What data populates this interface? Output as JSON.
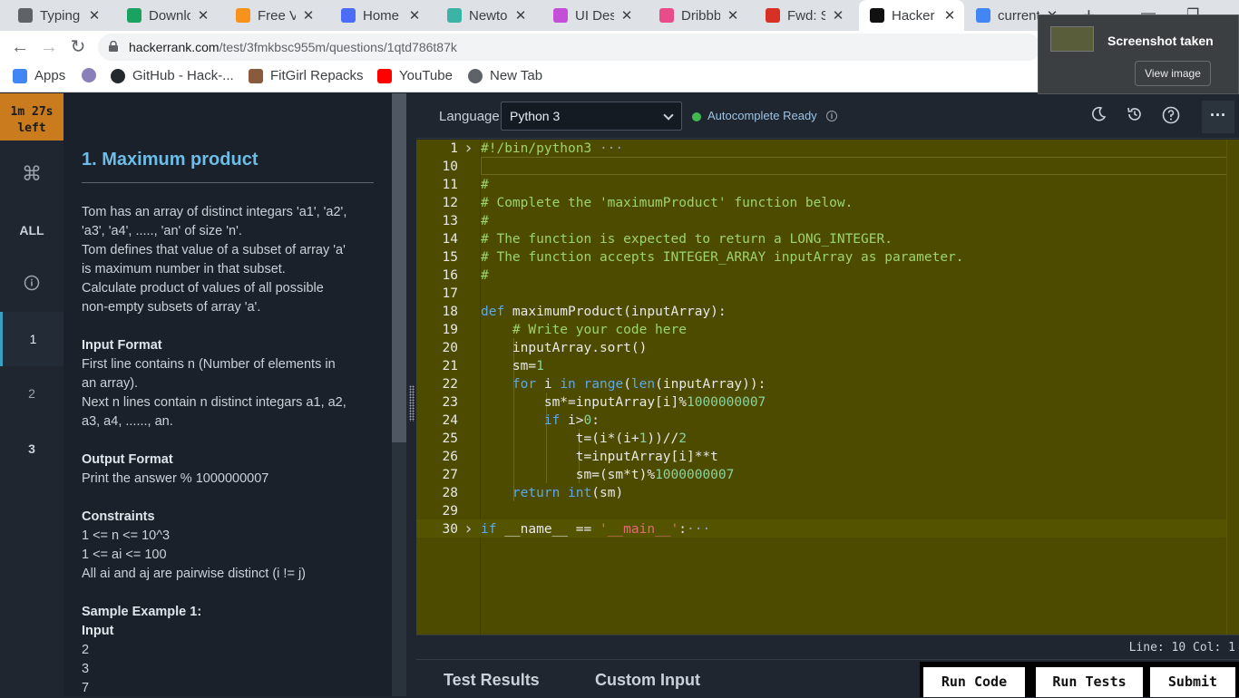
{
  "browser": {
    "tabs": [
      {
        "title": "Typing |",
        "fav_color": "#5f6368"
      },
      {
        "title": "Downlo",
        "fav_color": "#1aa260"
      },
      {
        "title": "Free Ve",
        "fav_color": "#f7931a"
      },
      {
        "title": "Home -",
        "fav_color": "#4a6cf7"
      },
      {
        "title": "Newton",
        "fav_color": "#3bb3a5"
      },
      {
        "title": "UI Desi",
        "fav_color": "#c34fd8"
      },
      {
        "title": "Dribbbl",
        "fav_color": "#ea4c89"
      },
      {
        "title": "Fwd: Sc",
        "fav_color": "#d93025"
      },
      {
        "title": "Hacker",
        "fav_color": "#111111"
      },
      {
        "title": "current",
        "fav_color": "#4285f4"
      }
    ],
    "close_glyph": "✕",
    "new_tab_glyph": "+",
    "url_host": "hackerrank.com",
    "url_path": "/test/3fmkbsc955m/questions/1qtd786t87k",
    "bookmarks": [
      {
        "label": "Apps",
        "color": "#4285f4"
      },
      {
        "label": "",
        "color": "#8a7fb8"
      },
      {
        "label": "GitHub - Hack-...",
        "color": "#24292e"
      },
      {
        "label": "FitGirl Repacks",
        "color": "#8a5a3c"
      },
      {
        "label": "YouTube",
        "color": "#ff0000"
      },
      {
        "label": "New Tab",
        "color": "#5f6368"
      }
    ]
  },
  "screenshot_popup": {
    "title": "Screenshot taken",
    "button": "View image"
  },
  "rail": {
    "timer_line1": "1m 27s",
    "timer_line2": "left",
    "all_label": "ALL",
    "items": [
      "1",
      "2",
      "3"
    ]
  },
  "question": {
    "title": "1. Maximum product",
    "description": [
      "Tom has an array of distinct integars 'a1', 'a2',",
      "'a3', 'a4', ....., 'an' of size 'n'.",
      "Tom defines that value of a subset of array 'a'",
      "is maximum number in that subset.",
      "Calculate product of values of all possible",
      "non-empty subsets of array 'a'."
    ],
    "input_heading": "Input Format",
    "input_lines": [
      "First line contains n (Number of elements in",
      "an array).",
      "Next n lines contain n distinct integars a1, a2,",
      "a3, a4, ......, an."
    ],
    "output_heading": "Output Format",
    "output_lines": [
      "Print the answer % 1000000007"
    ],
    "constraints_heading": "Constraints",
    "constraint_lines": [
      "1 <= n <= 10^3",
      "1 <= ai <= 100",
      "All ai and aj are pairwise distinct (i != j)"
    ],
    "sample_heading": "Sample Example 1:",
    "sample_input_heading": "Input",
    "sample_input_lines": [
      "2",
      "3",
      "7"
    ]
  },
  "editor": {
    "language_label": "Language",
    "language": "Python 3",
    "autocomplete": "Autocomplete Ready",
    "status": "Line: 10 Col: 1",
    "bottom_tabs": [
      "Test Results",
      "Custom Input"
    ],
    "buttons": [
      "Run Code",
      "Run Tests",
      "Submit"
    ],
    "code": [
      {
        "ln": "1",
        "fold": true,
        "text": "#!/bin/python3",
        "tail": " ···",
        "cls": "c-com"
      },
      {
        "ln": "10",
        "text": ""
      },
      {
        "ln": "11",
        "text": "#",
        "cls": "c-com"
      },
      {
        "ln": "12",
        "text": "# Complete the 'maximumProduct' function below.",
        "cls": "c-com"
      },
      {
        "ln": "13",
        "text": "#",
        "cls": "c-com"
      },
      {
        "ln": "14",
        "text": "# The function is expected to return a LONG_INTEGER.",
        "cls": "c-com"
      },
      {
        "ln": "15",
        "text": "# The function accepts INTEGER_ARRAY inputArray as parameter.",
        "cls": "c-com"
      },
      {
        "ln": "16",
        "text": "#",
        "cls": "c-com"
      },
      {
        "ln": "17",
        "text": ""
      },
      {
        "ln": "18",
        "text": "def maximumProduct(inputArray):"
      },
      {
        "ln": "19",
        "text": "    # Write your code here",
        "cls": "c-com"
      },
      {
        "ln": "20",
        "text": "    inputArray.sort()"
      },
      {
        "ln": "21",
        "text": "    sm=1"
      },
      {
        "ln": "22",
        "text": "    for i in range(len(inputArray)):"
      },
      {
        "ln": "23",
        "text": "        sm*=inputArray[i]%1000000007"
      },
      {
        "ln": "24",
        "text": "        if i>0:"
      },
      {
        "ln": "25",
        "text": "            t=(i*(i+1))//2"
      },
      {
        "ln": "26",
        "text": "            t=inputArray[i]**t"
      },
      {
        "ln": "27",
        "text": "            sm=(sm*t)%1000000007"
      },
      {
        "ln": "28",
        "text": "    return int(sm)"
      },
      {
        "ln": "29",
        "text": ""
      },
      {
        "ln": "30",
        "fold": true,
        "text": "if __name__ == '__main__':",
        "tail": "···"
      }
    ]
  }
}
